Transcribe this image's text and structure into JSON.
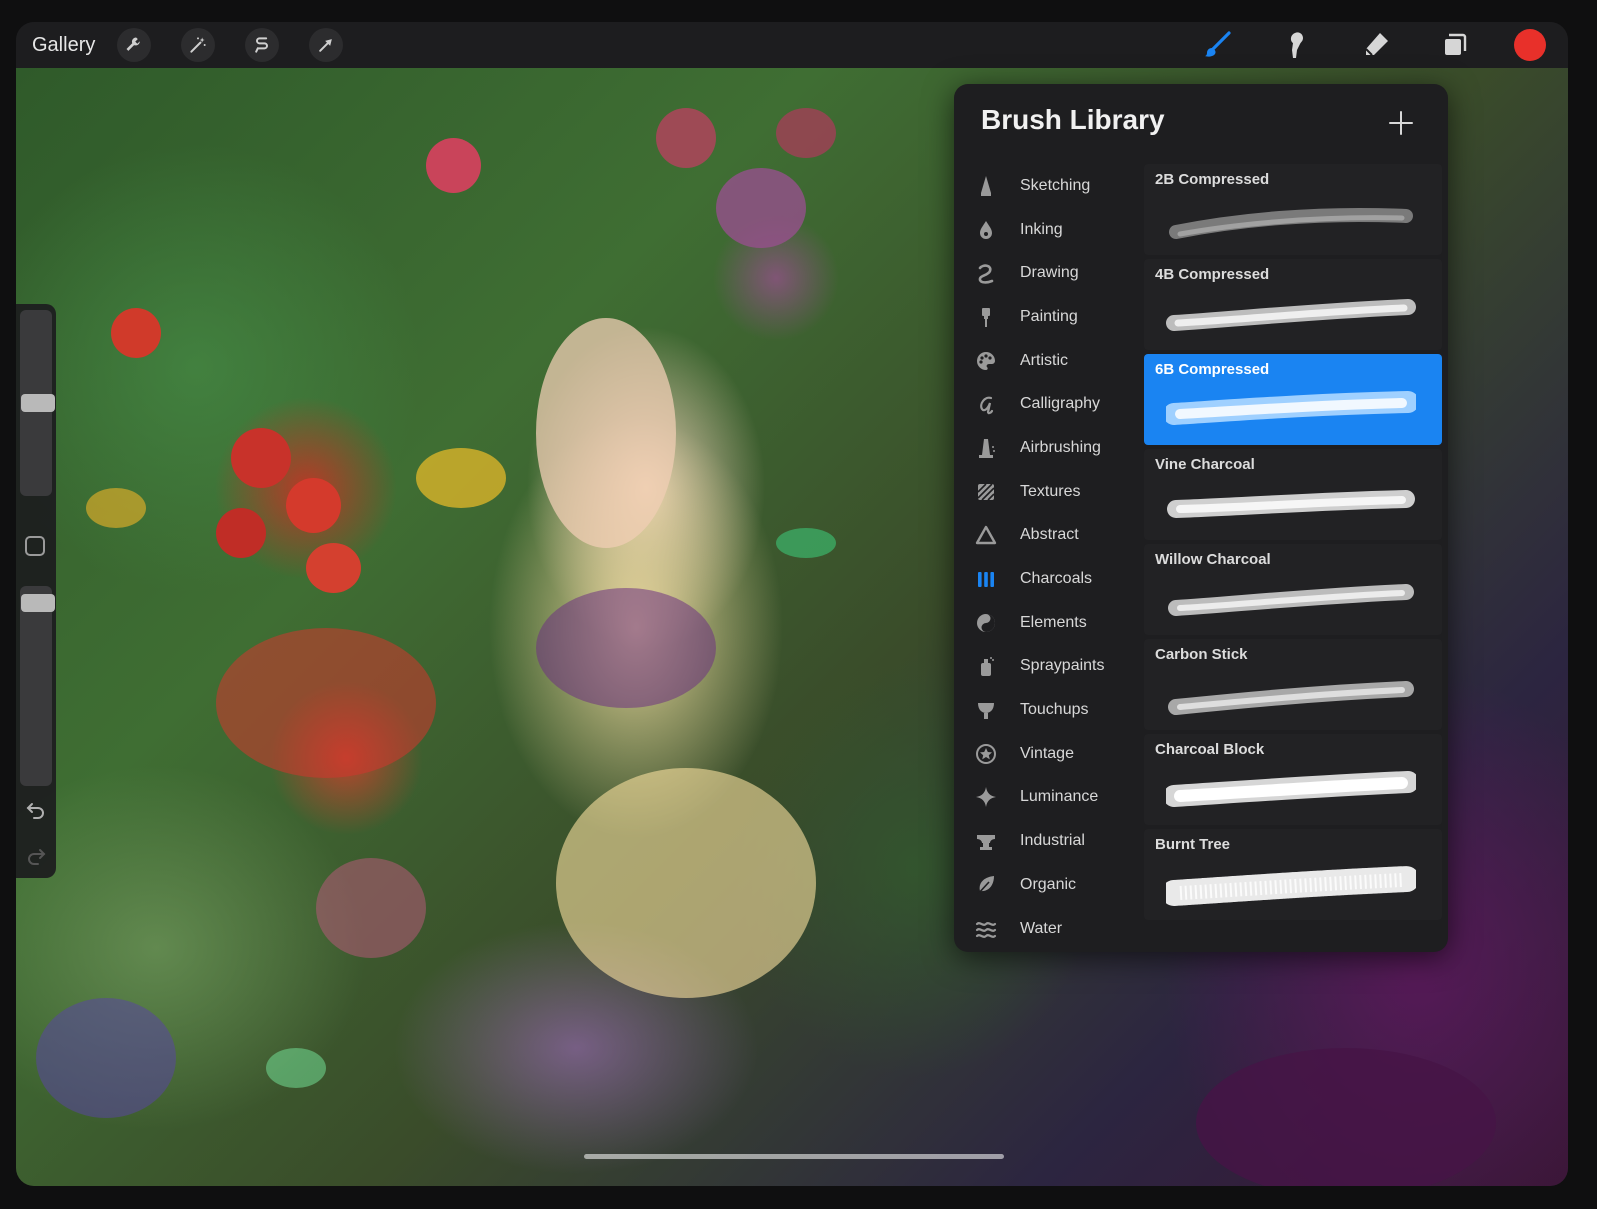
{
  "topbar": {
    "gallery_label": "Gallery",
    "left_tools": [
      "wrench-icon",
      "magic-wand-icon",
      "selection-icon",
      "transform-arrow-icon"
    ],
    "right_tools": [
      "brush-icon",
      "smudge-icon",
      "eraser-icon",
      "layers-icon"
    ],
    "active_tool": "brush-icon",
    "current_color": "#e8302a",
    "accent_color": "#1a84f2"
  },
  "sidebar": {
    "brush_size_level": 0.5,
    "opacity_level": 1.0
  },
  "brush_library": {
    "title": "Brush Library",
    "sets": [
      {
        "label": "Sketching",
        "icon": "pencil-tip-icon"
      },
      {
        "label": "Inking",
        "icon": "ink-drop-icon"
      },
      {
        "label": "Drawing",
        "icon": "squiggle-icon"
      },
      {
        "label": "Painting",
        "icon": "paint-brush-icon"
      },
      {
        "label": "Artistic",
        "icon": "palette-icon"
      },
      {
        "label": "Calligraphy",
        "icon": "calligraphy-a-icon"
      },
      {
        "label": "Airbrushing",
        "icon": "airbrush-icon"
      },
      {
        "label": "Textures",
        "icon": "texture-hatch-icon"
      },
      {
        "label": "Abstract",
        "icon": "triangle-icon"
      },
      {
        "label": "Charcoals",
        "icon": "charcoal-sticks-icon"
      },
      {
        "label": "Elements",
        "icon": "yin-yang-icon"
      },
      {
        "label": "Spraypaints",
        "icon": "spray-can-icon"
      },
      {
        "label": "Touchups",
        "icon": "touchup-icon"
      },
      {
        "label": "Vintage",
        "icon": "star-circle-icon"
      },
      {
        "label": "Luminance",
        "icon": "sparkle-icon"
      },
      {
        "label": "Industrial",
        "icon": "anvil-icon"
      },
      {
        "label": "Organic",
        "icon": "leaf-icon"
      },
      {
        "label": "Water",
        "icon": "waves-icon"
      }
    ],
    "active_set": "Charcoals",
    "brushes": [
      {
        "name": "2B Compressed"
      },
      {
        "name": "4B Compressed"
      },
      {
        "name": "6B Compressed"
      },
      {
        "name": "Vine Charcoal"
      },
      {
        "name": "Willow Charcoal"
      },
      {
        "name": "Carbon Stick"
      },
      {
        "name": "Charcoal Block"
      },
      {
        "name": "Burnt Tree"
      }
    ],
    "selected_brush": "6B Compressed"
  }
}
